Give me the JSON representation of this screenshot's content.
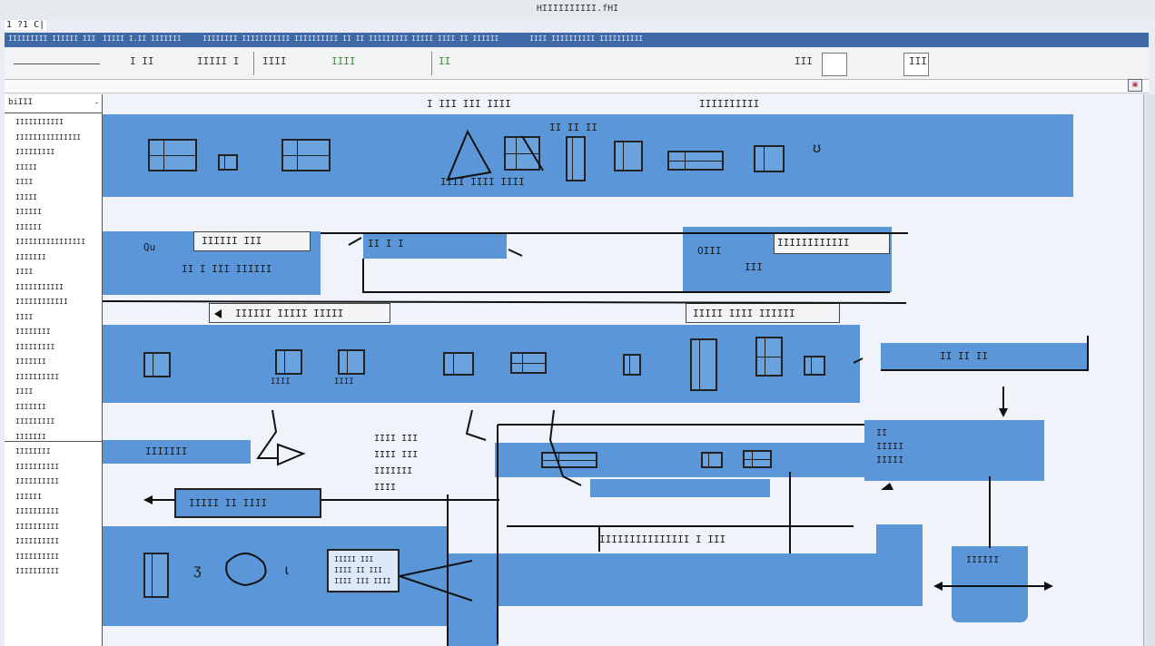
{
  "window": {
    "title": "HIIIIIIIIII.fHI",
    "app_name": "1 ?1 C|"
  },
  "menubar": {
    "items": [
      "IIIIIIIII IIIIII  III",
      "IIIII I.II IIIIIII",
      "IIIIIIII IIIIIIIIIII IIIIIIIIII II II IIIIIIIII",
      "IIIII IIII II IIIIII",
      "IIII IIIIIIIIII IIIIIIIIII"
    ]
  },
  "toolbar": {
    "items": [
      "I  II",
      "IIIII I",
      "IIII",
      "IIII",
      "II",
      "III",
      "III"
    ]
  },
  "sidebar": {
    "header": "biIII",
    "arrow": "-",
    "items": [
      "IIIIIIIIIII",
      "IIIIIIIIIIIIIII",
      "IIIIIIIII",
      "IIIII",
      "IIII",
      "IIIII",
      "IIIIII",
      "IIIIII",
      "IIIIIIIIIIIIIIII",
      "IIIIIII",
      "IIII",
      "IIIIIIIIIII",
      "IIIIIIIIIIII",
      "IIII",
      "IIIIIIII",
      "IIIIIIIII",
      "IIIIIII",
      "IIIIIIIIII",
      "IIII",
      "IIIIIII",
      "IIIIIIIII",
      "IIIIIII",
      "IIIIIIII",
      "IIIIIIIIII",
      "IIIIIIIIII",
      "IIIIII",
      "IIIIIIIIII",
      "IIIIIIIIII",
      "IIIIIIIIII",
      "IIIIIIIIII",
      "IIIIIIIIII"
    ]
  },
  "canvas": {
    "heading_left": "I III III IIII",
    "heading_right": "IIIIIIIIII",
    "band1_caption": "II II II",
    "band1_under": "IIII IIII IIII",
    "q_label": "Qu",
    "q_box": "IIIIII  III",
    "q_line": "II I  III IIIIII",
    "mid_bar": "II I  I",
    "o_label": "OIII",
    "o_box": "IIIIIIIIIIII",
    "o_line": "III",
    "arrow_label": "IIIIII IIIII IIIII",
    "right_label": "IIIII IIII IIIIII",
    "band3_cap1": "IIII",
    "band3_cap2": "IIII",
    "right_box": "II II  II",
    "side_text": "II\nIIIII\nIIIII",
    "mini_bar": "IIIIIII",
    "side_notes": [
      "IIII  III",
      "IIII  III",
      "IIIIIII",
      "IIII"
    ],
    "bottom_box": "IIIII II IIII",
    "long_label": "IIIIIIIIIIIIIII I III",
    "note_box": "IIIII III\nIIII II III\nIIII III IIII",
    "cup_text": "IIIIII"
  }
}
